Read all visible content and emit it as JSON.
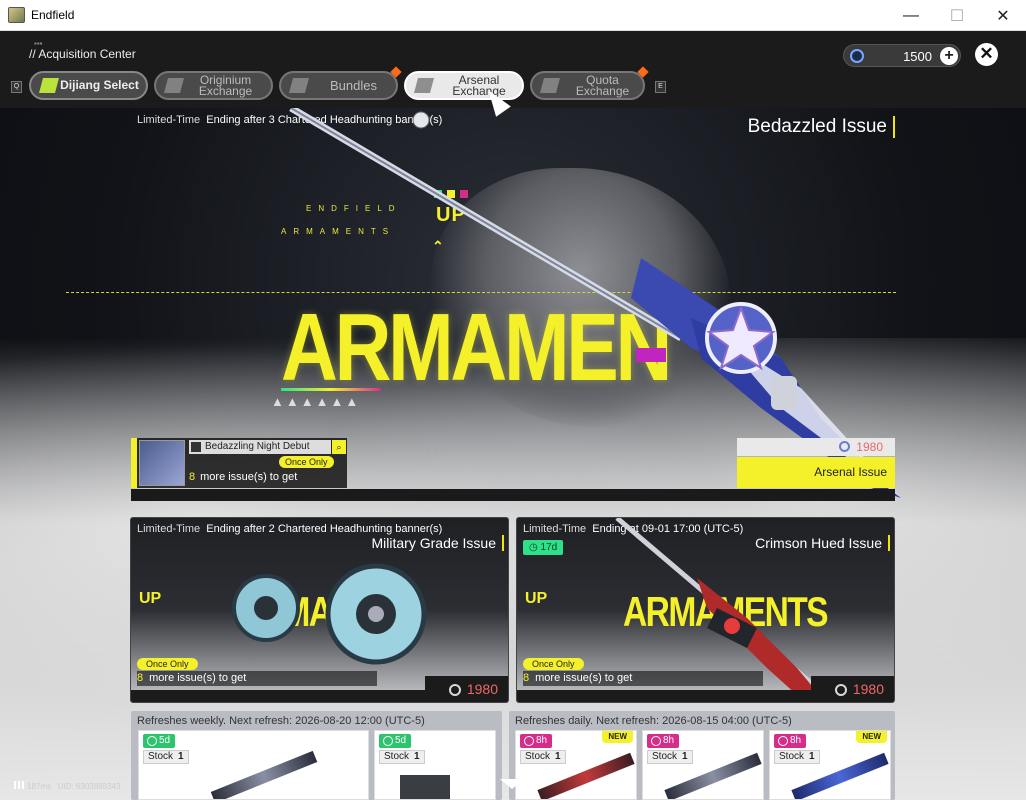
{
  "window": {
    "title": "Endfield",
    "minimize": "—",
    "maximize": "☐",
    "close": "✕"
  },
  "header": {
    "crumb_small": "▪▪▪",
    "crumb": "// Acquisition Center",
    "currency_amount": "1500",
    "currency_plus": "+",
    "close": "✕",
    "key_left": "Q",
    "key_right": "E"
  },
  "tabs": [
    {
      "label": "Dijiang Select",
      "icon": "dijiang-icon"
    },
    {
      "label": "Originium\nExchange",
      "icon": "originium-icon"
    },
    {
      "label": "Bundles",
      "icon": "bundles-icon",
      "badge": true
    },
    {
      "label": "Arsenal\nExchange",
      "icon": "arsenal-icon",
      "selected": true
    },
    {
      "label": "Quota\nExchange",
      "icon": "quota-icon",
      "badge": true
    }
  ],
  "featured": {
    "limited": "Limited-Time",
    "condition": "Ending after 3 Chartered Headhunting banner(s)",
    "title": "Bedazzled Issue",
    "big_text": "ARMAMEN",
    "endfield_text": "ENDFIELD",
    "armaments_text": "ARMAMENTS",
    "up_text": "UP",
    "weapon_name": "Bedazzling Night Debut",
    "search_icon": "⌕",
    "once_only": "Once Only",
    "more_count": "8",
    "more_text": "more issue(s) to get",
    "price": "1980",
    "price_label": "Arsenal Issue"
  },
  "cards": [
    {
      "limited": "Limited-Time",
      "condition": "Ending after 2 Chartered Headhunting banner(s)",
      "title": "Military Grade Issue",
      "up_text": "UP",
      "big_text": "ARMAM",
      "once_only": "Once Only",
      "more_count": "8",
      "more_text": "more issue(s) to get",
      "price": "1980"
    },
    {
      "limited": "Limited-Time",
      "condition": "Ending at 09-01 17:00 (UTC-5)",
      "days": "17d",
      "title": "Crimson Hued Issue",
      "up_text": "UP",
      "big_text": "ARMAMENTS",
      "once_only": "Once Only",
      "more_count": "8",
      "more_text": "more issue(s) to get",
      "price": "1980"
    }
  ],
  "weekly": {
    "title": "Refreshes weekly. Next refresh: 2026-08-20 12:00 (UTC-5)",
    "items": [
      {
        "days": "5d",
        "stock_label": "Stock",
        "stock": "1"
      },
      {
        "days": "5d",
        "stock_label": "Stock",
        "stock": "1"
      }
    ]
  },
  "daily": {
    "title": "Refreshes daily. Next refresh: 2026-08-15 04:00 (UTC-5)",
    "items": [
      {
        "days": "8h",
        "stock_label": "Stock",
        "stock": "1",
        "new": "NEW"
      },
      {
        "days": "8h",
        "stock_label": "Stock",
        "stock": "1"
      },
      {
        "days": "8h",
        "stock_label": "Stock",
        "stock": "1",
        "new": "NEW"
      }
    ]
  },
  "hud": {
    "ping": "187ms",
    "uid": "UID: 6303888343"
  },
  "colors": {
    "accent_yellow": "#f4f12a",
    "price_red": "#f06767",
    "green_timer": "#2ec46e",
    "pink_timer": "#d62d8a",
    "badge_orange": "#ff6a1a"
  }
}
